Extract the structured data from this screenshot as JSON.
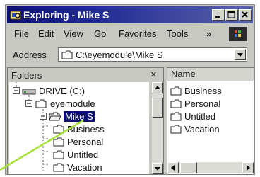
{
  "window": {
    "title": "Exploring - Mike S",
    "minimize_label": "_",
    "maximize_label": "□",
    "close_label": "×"
  },
  "menu": {
    "file": "File",
    "edit": "Edit",
    "view": "View",
    "go": "Go",
    "favorites": "Favorites",
    "tools": "Tools",
    "more": "»"
  },
  "address": {
    "label": "Address",
    "value": "C:\\eyemodule\\Mike S"
  },
  "folders_panel": {
    "title": "Folders",
    "close_label": "×",
    "tree": [
      {
        "label": "DRIVE (C:)",
        "expander": "−",
        "icon": "drive-icon"
      },
      {
        "label": "eyemodule",
        "expander": "−",
        "icon": "folder-icon"
      },
      {
        "label": "Mike S",
        "expander": "−",
        "icon": "open-folder-icon",
        "selected": true
      },
      {
        "label": "Business",
        "icon": "folder-icon"
      },
      {
        "label": "Personal",
        "icon": "folder-icon"
      },
      {
        "label": "Untitled",
        "icon": "folder-icon"
      },
      {
        "label": "Vacation",
        "icon": "folder-icon"
      }
    ]
  },
  "contents_panel": {
    "column_name": "Name",
    "items": [
      "Business",
      "Personal",
      "Untitled",
      "Vacation"
    ]
  },
  "colors": {
    "title_bar_start": "#0c0f74",
    "title_bar_end": "#5963a9",
    "selection": "#0c0f74",
    "chrome": "#c7c8c2",
    "callout_line": "#a8e03a"
  }
}
